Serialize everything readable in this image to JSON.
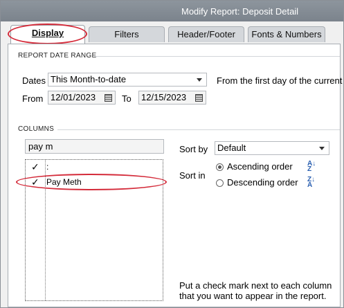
{
  "window": {
    "title": "Modify Report: Deposit Detail"
  },
  "tabs": [
    {
      "label": "Display",
      "active": true
    },
    {
      "label": "Filters",
      "active": false
    },
    {
      "label": "Header/Footer",
      "active": false
    },
    {
      "label": "Fonts & Numbers",
      "active": false
    }
  ],
  "date_range": {
    "section_title": "REPORT DATE RANGE",
    "dates_label": "Dates",
    "dates_value": "This Month-to-date",
    "description": "From the first day of the current m",
    "from_label": "From",
    "from_value": "12/01/2023",
    "to_label": "To",
    "to_value": "12/15/2023"
  },
  "columns": {
    "section_title": "COLUMNS",
    "search_value": "pay m",
    "rows": [
      {
        "check": "✓",
        "label": ":"
      },
      {
        "check": "✓",
        "label": "Pay Meth"
      }
    ]
  },
  "sort": {
    "sort_by_label": "Sort by",
    "sort_by_value": "Default",
    "sort_in_label": "Sort in",
    "ascending_label": "Ascending order",
    "descending_label": "Descending order",
    "ascending_selected": true,
    "ascending_icon": "sort-az-icon",
    "descending_icon": "sort-za-icon"
  },
  "help_text": {
    "line1": "Put a check mark next to each column",
    "line2": "that you want to appear in the report."
  },
  "colors": {
    "titlebar": "#848c94",
    "highlight_ellipse": "#d42b3a",
    "sort_icon": "#2a5fb0"
  }
}
